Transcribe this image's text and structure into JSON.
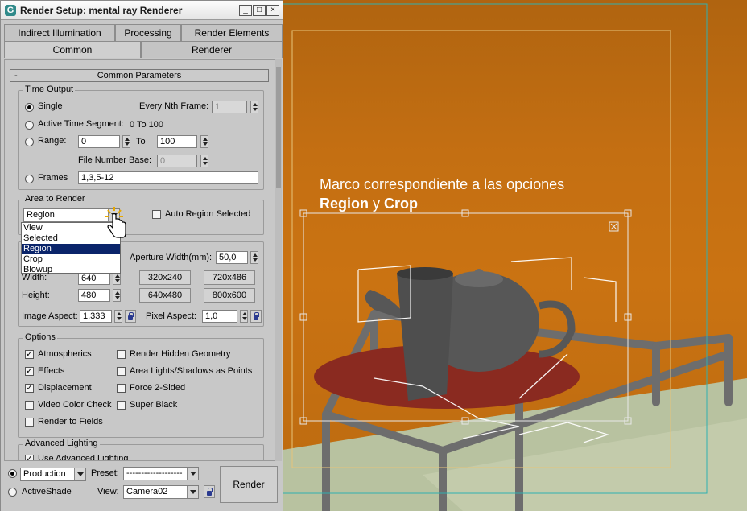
{
  "window": {
    "title": "Render Setup: mental ray Renderer",
    "app_icon": "3ds-max-icon",
    "controls": {
      "minimize": "_",
      "maximize": "□",
      "close": "×"
    }
  },
  "tabs_row1": [
    "Indirect Illumination",
    "Processing",
    "Render Elements"
  ],
  "tabs_row2": [
    "Common",
    "Renderer"
  ],
  "active_tab": "Common",
  "rollout": {
    "toggle": "-",
    "title": "Common Parameters"
  },
  "time_output": {
    "label": "Time Output",
    "single": "Single",
    "every_nth_label": "Every Nth Frame:",
    "every_nth_value": "1",
    "active_segment_label": "Active Time Segment:",
    "active_segment_value": "0 To 100",
    "range_label": "Range:",
    "range_from": "0",
    "range_to_label": "To",
    "range_to": "100",
    "file_number_base_label": "File Number Base:",
    "file_number_base_value": "0",
    "frames_label": "Frames",
    "frames_value": "1,3,5-12",
    "selected": "Single"
  },
  "area_to_render": {
    "label": "Area to Render",
    "selected": "Region",
    "options": [
      "View",
      "Selected",
      "Region",
      "Crop",
      "Blowup"
    ],
    "highlighted": "Region",
    "auto_region_label": "Auto Region Selected",
    "auto_region_checked": false
  },
  "output_size": {
    "aperture_label": "Aperture Width(mm):",
    "aperture_value": "50,0",
    "width_label": "Width:",
    "width_value": "640",
    "height_label": "Height:",
    "height_value": "480",
    "presets": [
      "320x240",
      "720x486",
      "640x480",
      "800x600"
    ],
    "image_aspect_label": "Image Aspect:",
    "image_aspect_value": "1,333",
    "pixel_aspect_label": "Pixel Aspect:",
    "pixel_aspect_value": "1,0"
  },
  "options": {
    "label": "Options",
    "left": [
      {
        "label": "Atmospherics",
        "checked": true
      },
      {
        "label": "Effects",
        "checked": true
      },
      {
        "label": "Displacement",
        "checked": true
      },
      {
        "label": "Video Color Check",
        "checked": false
      },
      {
        "label": "Render to Fields",
        "checked": false
      }
    ],
    "right": [
      {
        "label": "Render Hidden Geometry",
        "checked": false
      },
      {
        "label": "Area Lights/Shadows as Points",
        "checked": false
      },
      {
        "label": "Force 2-Sided",
        "checked": false
      },
      {
        "label": "Super Black",
        "checked": false
      }
    ]
  },
  "advanced_lighting": {
    "label": "Advanced Lighting",
    "use_label": "Use Advanced Lighting",
    "use_checked": true
  },
  "bottom": {
    "production_label": "Production",
    "activeshade_label": "ActiveShade",
    "preset_label": "Preset:",
    "preset_value": "-------------------",
    "view_label": "View:",
    "view_value": "Camera02",
    "render_label": "Render",
    "mode": "Production"
  },
  "viewport": {
    "caption_line1": "Marco correspondiente a las opciones",
    "caption_region": "Region",
    "caption_y": " y ",
    "caption_crop": "Crop",
    "colors": {
      "floor": "#b8c2a0",
      "wall": "#c46f12",
      "plate": "#8a2a20",
      "object": "#5a5a5a"
    }
  }
}
